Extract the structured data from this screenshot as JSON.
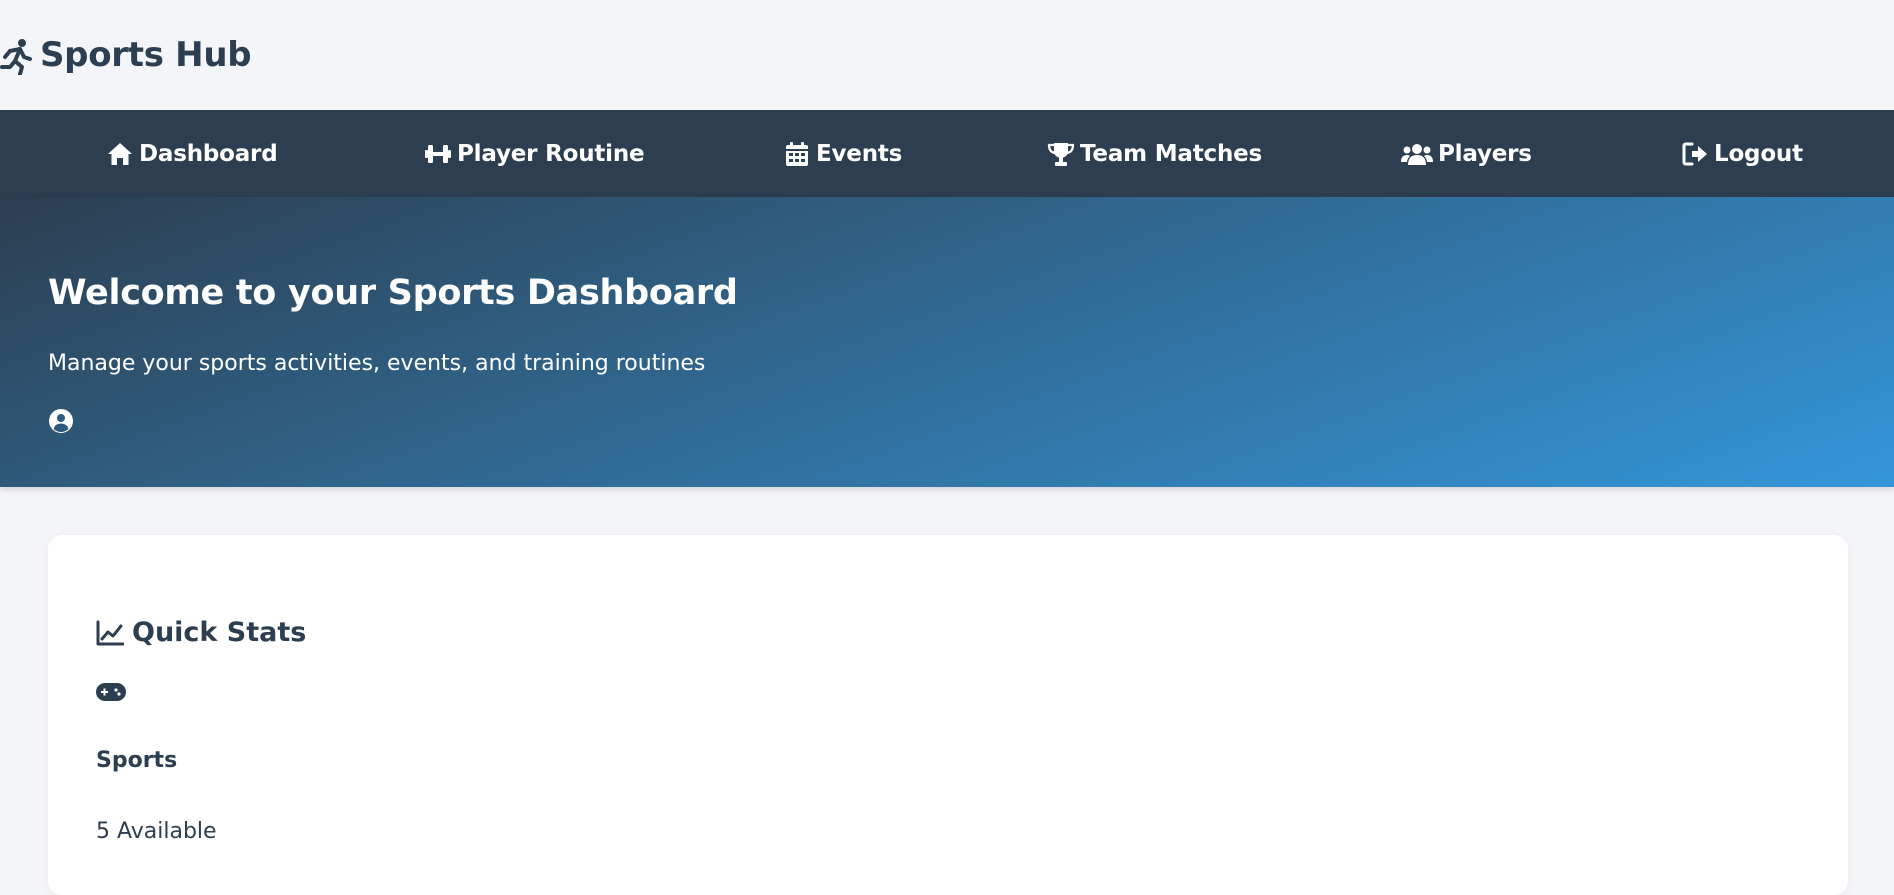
{
  "app": {
    "title": "Sports Hub",
    "logo_icon": "running-person-icon"
  },
  "nav": {
    "items": [
      {
        "label": "Dashboard",
        "icon": "home-icon"
      },
      {
        "label": "Player Routine",
        "icon": "dumbbell-icon"
      },
      {
        "label": "Events",
        "icon": "calendar-icon"
      },
      {
        "label": "Team Matches",
        "icon": "trophy-icon"
      },
      {
        "label": "Players",
        "icon": "users-icon"
      },
      {
        "label": "Logout",
        "icon": "logout-icon"
      }
    ]
  },
  "hero": {
    "title": "Welcome to your Sports Dashboard",
    "subtitle": "Manage your sports activities, events, and training routines",
    "user_icon": "user-circle-icon"
  },
  "quick_stats": {
    "title": "Quick Stats",
    "title_icon": "chart-line-icon",
    "items": [
      {
        "icon": "gamepad-icon",
        "name": "Sports",
        "value": "5 Available"
      }
    ]
  },
  "colors": {
    "nav_bg": "#2c3e50",
    "hero_gradient_start": "#2c3e50",
    "hero_gradient_end": "#3496d9",
    "page_bg": "#f4f5f8",
    "text": "#2c3e50"
  }
}
